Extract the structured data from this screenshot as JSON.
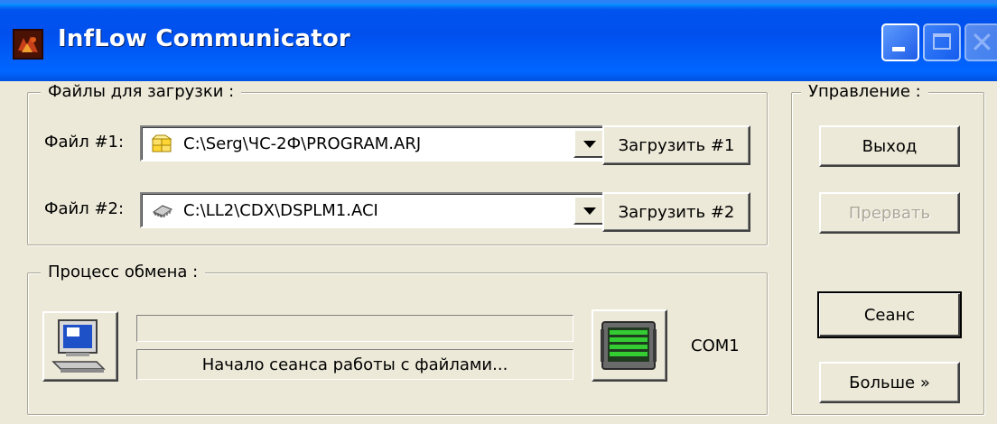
{
  "window": {
    "title": "InfLow Communicator",
    "icons": {
      "app": "app-icon",
      "minimize": "minimize-icon",
      "maximize": "maximize-icon",
      "close": "close-icon"
    }
  },
  "files_group": {
    "title": "Файлы для загрузки :",
    "file1": {
      "label": "Файл #1:",
      "value": "C:\\Serg\\ЧС-2Ф\\PROGRAM.ARJ",
      "icon": "archive-stack-icon",
      "button": "Загрузить #1"
    },
    "file2": {
      "label": "Файл #2:",
      "value": "C:\\LL2\\CDX\\DSPLM1.ACI",
      "icon": "chip-icon",
      "button": "Загрузить #2"
    }
  },
  "exchange_group": {
    "title": "Процесс обмена :",
    "progress": 0,
    "status": "Начало сеанса работы с файлами...",
    "port": "COM1",
    "icons": {
      "computer": "computer-icon",
      "device": "device-icon"
    }
  },
  "control_group": {
    "title": "Управление :",
    "exit": "Выход",
    "abort": "Прервать",
    "session": "Сеанс",
    "more": "Больше »"
  },
  "colors": {
    "titlebar": "#0053ee",
    "face": "#ece9d8",
    "disabled_text": "#aca899",
    "device_green": "#33cc33"
  }
}
